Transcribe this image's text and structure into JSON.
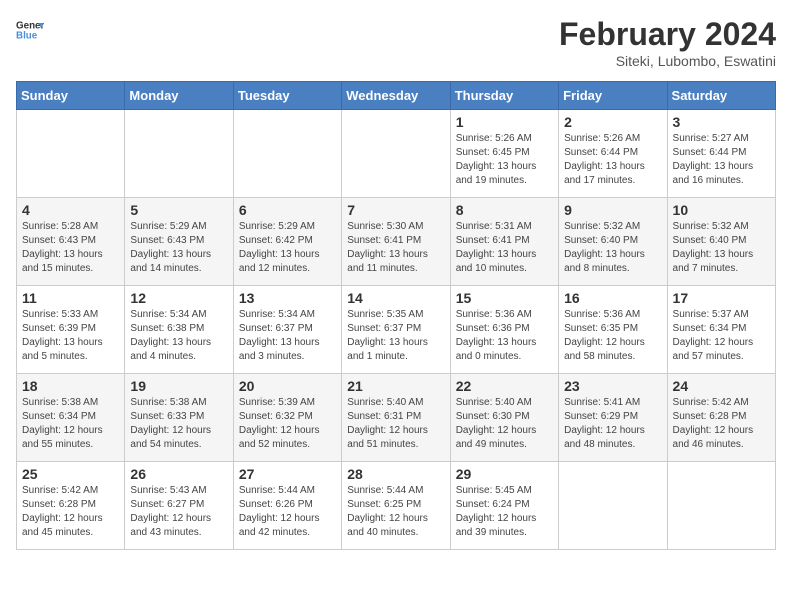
{
  "header": {
    "logo_general": "General",
    "logo_blue": "Blue",
    "title": "February 2024",
    "subtitle": "Siteki, Lubombo, Eswatini"
  },
  "days_of_week": [
    "Sunday",
    "Monday",
    "Tuesday",
    "Wednesday",
    "Thursday",
    "Friday",
    "Saturday"
  ],
  "weeks": [
    [
      {
        "day": "",
        "info": ""
      },
      {
        "day": "",
        "info": ""
      },
      {
        "day": "",
        "info": ""
      },
      {
        "day": "",
        "info": ""
      },
      {
        "day": "1",
        "info": "Sunrise: 5:26 AM\nSunset: 6:45 PM\nDaylight: 13 hours and 19 minutes."
      },
      {
        "day": "2",
        "info": "Sunrise: 5:26 AM\nSunset: 6:44 PM\nDaylight: 13 hours and 17 minutes."
      },
      {
        "day": "3",
        "info": "Sunrise: 5:27 AM\nSunset: 6:44 PM\nDaylight: 13 hours and 16 minutes."
      }
    ],
    [
      {
        "day": "4",
        "info": "Sunrise: 5:28 AM\nSunset: 6:43 PM\nDaylight: 13 hours and 15 minutes."
      },
      {
        "day": "5",
        "info": "Sunrise: 5:29 AM\nSunset: 6:43 PM\nDaylight: 13 hours and 14 minutes."
      },
      {
        "day": "6",
        "info": "Sunrise: 5:29 AM\nSunset: 6:42 PM\nDaylight: 13 hours and 12 minutes."
      },
      {
        "day": "7",
        "info": "Sunrise: 5:30 AM\nSunset: 6:41 PM\nDaylight: 13 hours and 11 minutes."
      },
      {
        "day": "8",
        "info": "Sunrise: 5:31 AM\nSunset: 6:41 PM\nDaylight: 13 hours and 10 minutes."
      },
      {
        "day": "9",
        "info": "Sunrise: 5:32 AM\nSunset: 6:40 PM\nDaylight: 13 hours and 8 minutes."
      },
      {
        "day": "10",
        "info": "Sunrise: 5:32 AM\nSunset: 6:40 PM\nDaylight: 13 hours and 7 minutes."
      }
    ],
    [
      {
        "day": "11",
        "info": "Sunrise: 5:33 AM\nSunset: 6:39 PM\nDaylight: 13 hours and 5 minutes."
      },
      {
        "day": "12",
        "info": "Sunrise: 5:34 AM\nSunset: 6:38 PM\nDaylight: 13 hours and 4 minutes."
      },
      {
        "day": "13",
        "info": "Sunrise: 5:34 AM\nSunset: 6:37 PM\nDaylight: 13 hours and 3 minutes."
      },
      {
        "day": "14",
        "info": "Sunrise: 5:35 AM\nSunset: 6:37 PM\nDaylight: 13 hours and 1 minute."
      },
      {
        "day": "15",
        "info": "Sunrise: 5:36 AM\nSunset: 6:36 PM\nDaylight: 13 hours and 0 minutes."
      },
      {
        "day": "16",
        "info": "Sunrise: 5:36 AM\nSunset: 6:35 PM\nDaylight: 12 hours and 58 minutes."
      },
      {
        "day": "17",
        "info": "Sunrise: 5:37 AM\nSunset: 6:34 PM\nDaylight: 12 hours and 57 minutes."
      }
    ],
    [
      {
        "day": "18",
        "info": "Sunrise: 5:38 AM\nSunset: 6:34 PM\nDaylight: 12 hours and 55 minutes."
      },
      {
        "day": "19",
        "info": "Sunrise: 5:38 AM\nSunset: 6:33 PM\nDaylight: 12 hours and 54 minutes."
      },
      {
        "day": "20",
        "info": "Sunrise: 5:39 AM\nSunset: 6:32 PM\nDaylight: 12 hours and 52 minutes."
      },
      {
        "day": "21",
        "info": "Sunrise: 5:40 AM\nSunset: 6:31 PM\nDaylight: 12 hours and 51 minutes."
      },
      {
        "day": "22",
        "info": "Sunrise: 5:40 AM\nSunset: 6:30 PM\nDaylight: 12 hours and 49 minutes."
      },
      {
        "day": "23",
        "info": "Sunrise: 5:41 AM\nSunset: 6:29 PM\nDaylight: 12 hours and 48 minutes."
      },
      {
        "day": "24",
        "info": "Sunrise: 5:42 AM\nSunset: 6:28 PM\nDaylight: 12 hours and 46 minutes."
      }
    ],
    [
      {
        "day": "25",
        "info": "Sunrise: 5:42 AM\nSunset: 6:28 PM\nDaylight: 12 hours and 45 minutes."
      },
      {
        "day": "26",
        "info": "Sunrise: 5:43 AM\nSunset: 6:27 PM\nDaylight: 12 hours and 43 minutes."
      },
      {
        "day": "27",
        "info": "Sunrise: 5:44 AM\nSunset: 6:26 PM\nDaylight: 12 hours and 42 minutes."
      },
      {
        "day": "28",
        "info": "Sunrise: 5:44 AM\nSunset: 6:25 PM\nDaylight: 12 hours and 40 minutes."
      },
      {
        "day": "29",
        "info": "Sunrise: 5:45 AM\nSunset: 6:24 PM\nDaylight: 12 hours and 39 minutes."
      },
      {
        "day": "",
        "info": ""
      },
      {
        "day": "",
        "info": ""
      }
    ]
  ]
}
